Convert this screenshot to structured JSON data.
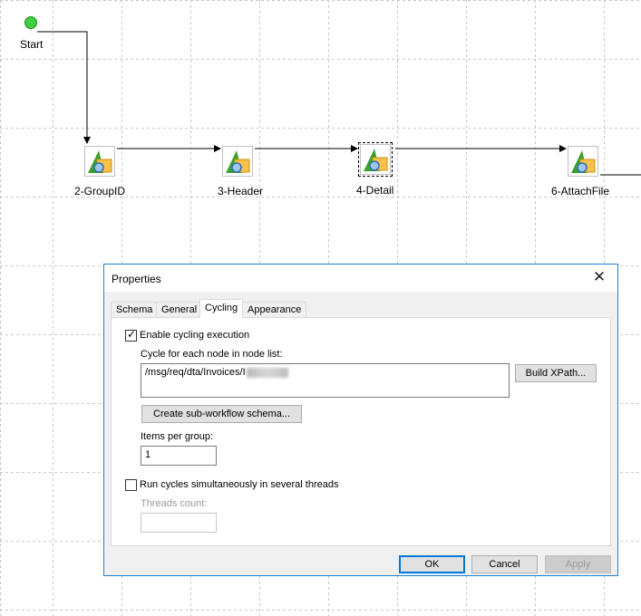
{
  "workflow": {
    "start_label": "Start",
    "nodes": [
      {
        "label": "2-GroupID"
      },
      {
        "label": "3-Header"
      },
      {
        "label": "4-Detail"
      },
      {
        "label": "6-AttachFile"
      }
    ]
  },
  "dialog": {
    "title": "Properties",
    "close_glyph": "✕",
    "tabs": [
      "Schema",
      "General",
      "Cycling",
      "Appearance"
    ],
    "active_tab": "Cycling",
    "enable_cycling": {
      "label": "Enable cycling execution",
      "checked": true
    },
    "node_list_label": "Cycle for each node in node list:",
    "node_list_value": "/msg/req/dta/Invoices/I",
    "build_xpath_label": "Build XPath...",
    "create_subworkflow_label": "Create sub-workflow schema...",
    "items_per_group_label": "Items per group:",
    "items_per_group_value": "1",
    "run_simultaneously": {
      "label": "Run cycles simultaneously in several threads",
      "checked": false
    },
    "threads_count_label": "Threads count:",
    "threads_count_value": "",
    "buttons": {
      "ok": "OK",
      "cancel": "Cancel",
      "apply": "Apply"
    }
  },
  "icons": {
    "node": "workflow-step-icon",
    "check": "✓"
  },
  "colors": {
    "accent": "#0078d7",
    "start_node": "#3fcf3f",
    "dialog_border": "#1883d7"
  }
}
